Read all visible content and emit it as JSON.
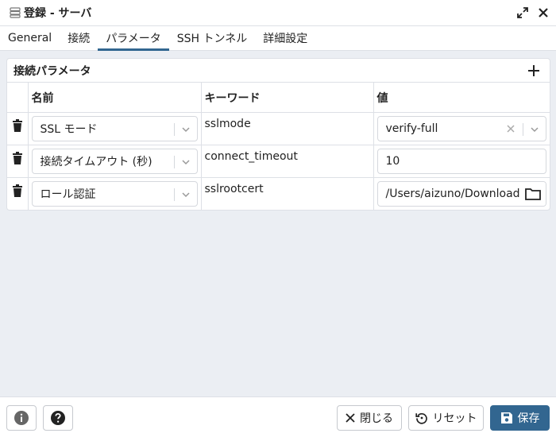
{
  "window": {
    "title": "登録 - サーバ",
    "icons": [
      "server-icon",
      "expand-icon",
      "close-icon"
    ]
  },
  "tabs": [
    {
      "label": "General",
      "active": false
    },
    {
      "label": "接続",
      "active": false
    },
    {
      "label": "パラメータ",
      "active": true
    },
    {
      "label": "SSH トンネル",
      "active": false
    },
    {
      "label": "詳細設定",
      "active": false
    }
  ],
  "panel": {
    "title": "接続パラメータ",
    "columns": [
      "",
      "名前",
      "キーワード",
      "値"
    ],
    "rows": [
      {
        "name": "SSL モード",
        "keyword": "sslmode",
        "value": "verify-full",
        "value_type": "select"
      },
      {
        "name": "接続タイムアウト (秒)",
        "keyword": "connect_timeout",
        "value": "10",
        "value_type": "input"
      },
      {
        "name": "ロール認証",
        "keyword": "sslrootcert",
        "value": "/Users/aizuno/Download",
        "value_type": "file"
      }
    ]
  },
  "footer": {
    "close_label": "閉じる",
    "reset_label": "リセット",
    "save_label": "保存"
  },
  "colors": {
    "accent": "#326690",
    "background": "#ebeef3",
    "border": "#dde0e6"
  }
}
